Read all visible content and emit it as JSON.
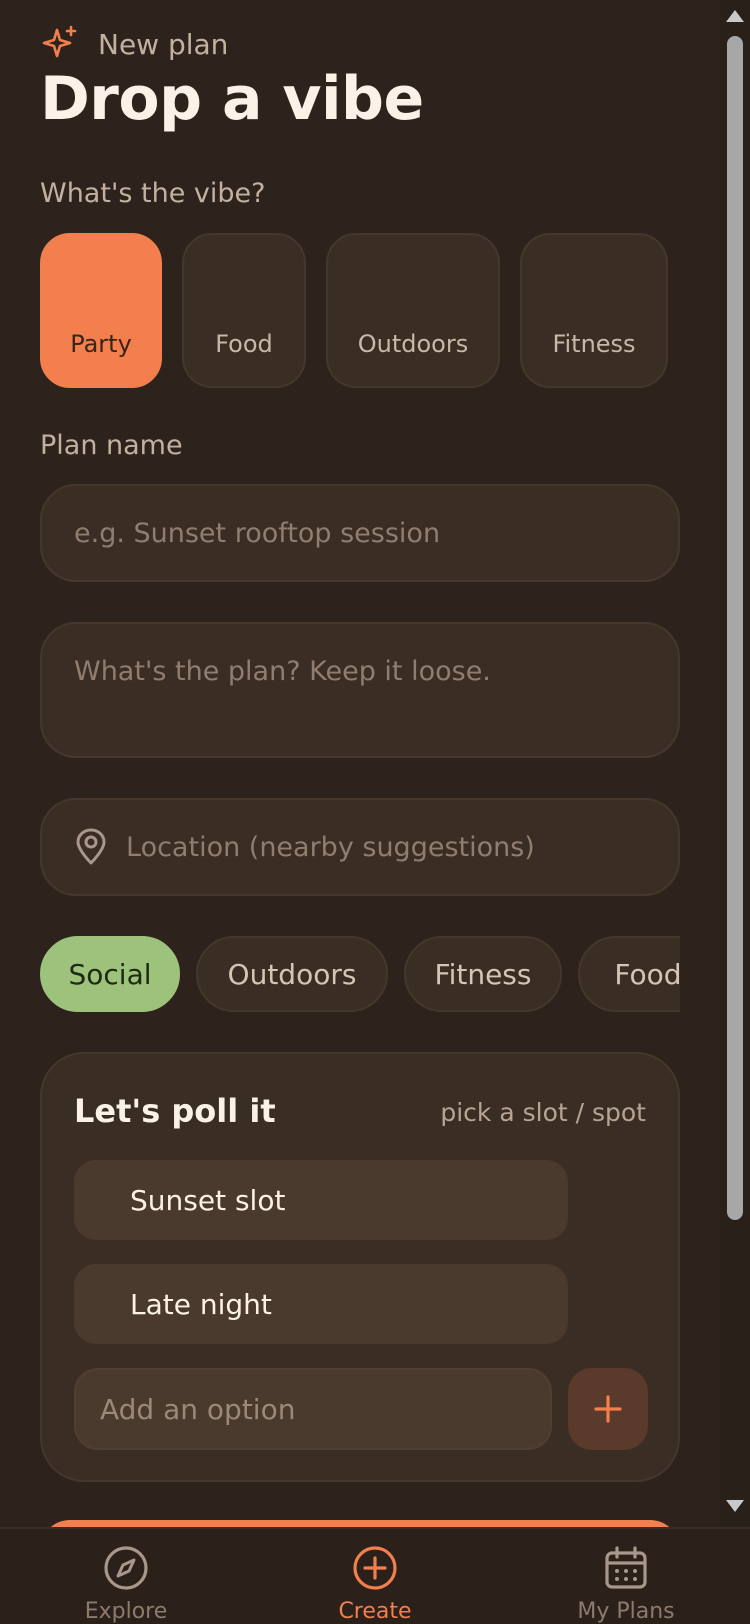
{
  "header": {
    "eyebrow": "New plan",
    "title": "Drop a vibe"
  },
  "vibe": {
    "label": "What's the vibe?",
    "options": [
      {
        "label": "Party",
        "active": true
      },
      {
        "label": "Food",
        "active": false
      },
      {
        "label": "Outdoors",
        "active": false
      },
      {
        "label": "Fitness",
        "active": false
      }
    ]
  },
  "plan_name": {
    "label": "Plan name",
    "placeholder": "e.g. Sunset rooftop session"
  },
  "description": {
    "placeholder": "What's the plan? Keep it loose."
  },
  "location": {
    "placeholder": "Location (nearby suggestions)"
  },
  "tags": [
    {
      "label": "Social",
      "active": true
    },
    {
      "label": "Outdoors",
      "active": false
    },
    {
      "label": "Fitness",
      "active": false
    },
    {
      "label": "Food",
      "active": false
    }
  ],
  "poll": {
    "title": "Let's poll it",
    "hint": "pick a slot / spot",
    "options": [
      "Sunset slot",
      "Late night"
    ],
    "add_placeholder": "Add an option"
  },
  "tabbar": {
    "items": [
      {
        "label": "Explore",
        "icon": "compass-icon",
        "active": false
      },
      {
        "label": "Create",
        "icon": "plus-circle-icon",
        "active": true
      },
      {
        "label": "My Plans",
        "icon": "calendar-icon",
        "active": false
      }
    ]
  },
  "colors": {
    "background": "#2e231c",
    "accent": "#f27f4d",
    "tag_active": "#9dc27b",
    "card": "#3a2d23"
  }
}
